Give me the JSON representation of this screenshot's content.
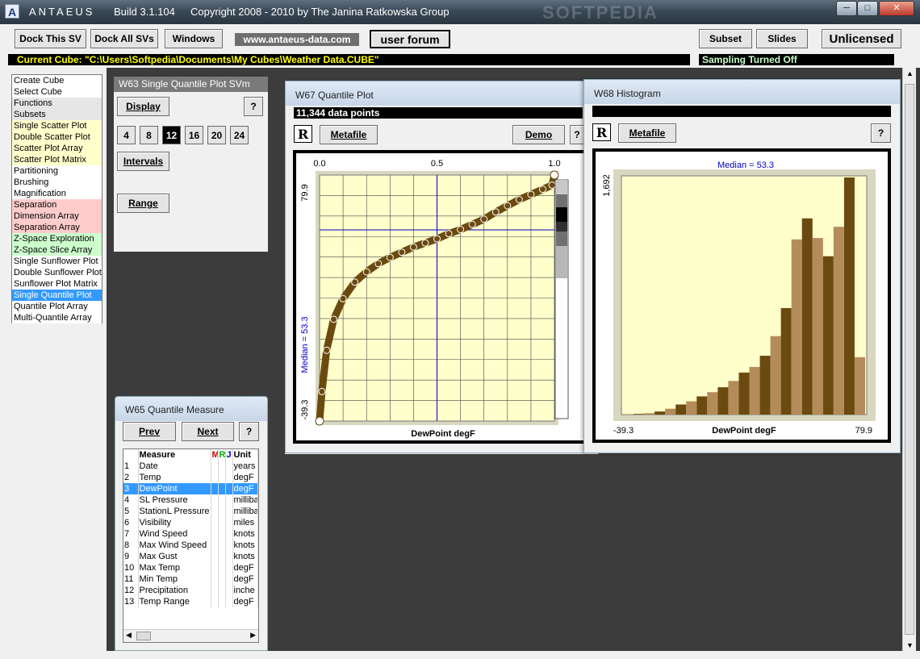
{
  "titlebar": {
    "app": "ANTAEUS",
    "build": "Build 3.1.104",
    "copyright": "Copyright 2008 - 2010 by The Janina Ratkowska Group",
    "watermark": "SOFTPEDIA"
  },
  "toolbar": {
    "dock_this": "Dock This SV",
    "dock_all": "Dock All SVs",
    "windows": "Windows",
    "site": "www.antaeus-data.com",
    "forum": "user forum",
    "subset": "Subset",
    "slides": "Slides",
    "license": "Unlicensed",
    "current_cube": "Current Cube: \"C:\\Users\\Softpedia\\Documents\\My Cubes\\Weather Data.CUBE\"",
    "sampling": "Sampling Turned Off"
  },
  "functions": [
    {
      "label": "Create Cube",
      "color": "#ffffff"
    },
    {
      "label": "Select Cube",
      "color": "#ffffff"
    },
    {
      "label": "Functions",
      "color": "#e6e6e6"
    },
    {
      "label": "Subsets",
      "color": "#e6e6e6"
    },
    {
      "label": "Single Scatter Plot",
      "color": "#ffffcc"
    },
    {
      "label": "Double Scatter Plot",
      "color": "#ffffcc"
    },
    {
      "label": "Scatter Plot Array",
      "color": "#ffffcc"
    },
    {
      "label": "Scatter Plot Matrix",
      "color": "#ffffcc"
    },
    {
      "label": "Partitioning",
      "color": "#ffffff"
    },
    {
      "label": "Brushing",
      "color": "#ffffff"
    },
    {
      "label": "Magnification",
      "color": "#ffffff"
    },
    {
      "label": "Separation",
      "color": "#ffcccc"
    },
    {
      "label": "Dimension Array",
      "color": "#ffcccc"
    },
    {
      "label": "Separation Array",
      "color": "#ffcccc"
    },
    {
      "label": "Z-Space Exploration",
      "color": "#ccffcc"
    },
    {
      "label": "Z-Space Slice Array",
      "color": "#ccffcc"
    },
    {
      "label": "Single Sunflower Plot",
      "color": "#ffffff"
    },
    {
      "label": "Double Sunflower Plot",
      "color": "#ffffff"
    },
    {
      "label": "Sunflower Plot Matrix",
      "color": "#ffffff"
    },
    {
      "label": "Single Quantile Plot",
      "color": "#3399ff",
      "selected": true
    },
    {
      "label": "Quantile Plot Array",
      "color": "#ffffff"
    },
    {
      "label": "Multi-Quantile Array",
      "color": "#ffffff"
    }
  ],
  "w63": {
    "title": "W63  Single Quantile Plot SVm",
    "display": "Display",
    "help": "?",
    "counts": [
      "4",
      "8",
      "12",
      "16",
      "20",
      "24"
    ],
    "selected_count": "12",
    "intervals": "Intervals",
    "range": "Range"
  },
  "w65": {
    "title": "W65  Quantile Measure",
    "prev": "Prev",
    "next": "Next",
    "help": "?",
    "headers": {
      "measure": "Measure",
      "m": "M",
      "r": "R",
      "j": "J",
      "unit": "Unit"
    },
    "rows": [
      {
        "n": "1",
        "name": "Date",
        "unit": "years"
      },
      {
        "n": "2",
        "name": "Temp",
        "unit": "degF"
      },
      {
        "n": "3",
        "name": "DewPoint",
        "unit": "degF",
        "selected": true
      },
      {
        "n": "4",
        "name": "SL Pressure",
        "unit": "milliba"
      },
      {
        "n": "5",
        "name": "StationL Pressure",
        "unit": "milliba"
      },
      {
        "n": "6",
        "name": "Visibility",
        "unit": "miles"
      },
      {
        "n": "7",
        "name": "Wind Speed",
        "unit": "knots"
      },
      {
        "n": "8",
        "name": "Max Wind Speed",
        "unit": "knots"
      },
      {
        "n": "9",
        "name": "Max Gust",
        "unit": "knots"
      },
      {
        "n": "10",
        "name": "Max Temp",
        "unit": "degF"
      },
      {
        "n": "11",
        "name": "Min Temp",
        "unit": "degF"
      },
      {
        "n": "12",
        "name": "Precipitation",
        "unit": "inche"
      },
      {
        "n": "13",
        "name": "Temp Range",
        "unit": "degF"
      }
    ]
  },
  "w67": {
    "title": "W67  Quantile Plot",
    "info": "11,344 data points",
    "r": "R",
    "metafile": "Metafile",
    "demo": "Demo",
    "help": "?",
    "x_ticks": [
      "0.0",
      "0.5",
      "1.0"
    ],
    "y_top": "79.9",
    "y_bottom": "-39.3",
    "median_label": "Median = 53.3",
    "xlabel": "DewPoint  degF"
  },
  "w68": {
    "title": "W68  Histogram",
    "r": "R",
    "metafile": "Metafile",
    "help": "?",
    "y_top": "1,692",
    "median_label": "Median = 53.3",
    "x_left": "-39.3",
    "x_right": "79.9",
    "xlabel": "DewPoint  degF"
  },
  "chart_data": [
    {
      "type": "scatter",
      "x": [
        0.0,
        0.01,
        0.03,
        0.06,
        0.1,
        0.15,
        0.2,
        0.25,
        0.3,
        0.35,
        0.4,
        0.45,
        0.5,
        0.55,
        0.6,
        0.65,
        0.7,
        0.75,
        0.8,
        0.85,
        0.9,
        0.95,
        0.99,
        1.0
      ],
      "y": [
        -39.3,
        -25,
        -5,
        10,
        20,
        28,
        33,
        37,
        40,
        42.5,
        45,
        47,
        49,
        51.5,
        53.5,
        56,
        58.5,
        62,
        65,
        68,
        70.5,
        73,
        75,
        79.9
      ],
      "xlim": [
        0,
        1
      ],
      "ylim": [
        -39.3,
        79.9
      ],
      "xlabel": "DewPoint  degF",
      "grid": true,
      "annotations": [
        "Median = 53.3"
      ]
    },
    {
      "type": "bar",
      "values": [
        3,
        5,
        10,
        22,
        42,
        72,
        95,
        130,
        160,
        195,
        240,
        300,
        340,
        420,
        560,
        760,
        1250,
        1400,
        1260,
        1130,
        1340,
        1692,
        410
      ],
      "ylim": [
        0,
        1692
      ],
      "xlim": [
        -39.3,
        79.9
      ],
      "xlabel": "DewPoint  degF",
      "annotations": [
        "Median = 53.3"
      ]
    }
  ],
  "colors": {
    "quantile_curve": "#6b4a10",
    "plot_bg": "#ffffcc",
    "histogram_dark": "#6b4a10",
    "histogram_light": "#b48c5a",
    "selection": "#3399ff",
    "cube_text": "#ffff00"
  }
}
